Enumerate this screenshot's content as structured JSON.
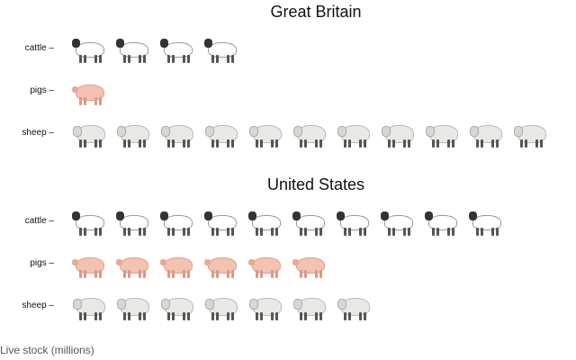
{
  "chart_data": {
    "type": "pictogram",
    "caption": "Live stock (millions)",
    "categories": [
      "cattle",
      "pigs",
      "sheep"
    ],
    "panels": [
      {
        "title": "Great Britain",
        "values": {
          "cattle": 4,
          "pigs": 1,
          "sheep": 11
        }
      },
      {
        "title": "United States",
        "values": {
          "cattle": 10,
          "pigs": 6,
          "sheep": 7
        }
      }
    ],
    "colors": {
      "cattle": "#ffffff",
      "pigs": "#f3c2b0",
      "sheep": "#e8e8e4"
    }
  }
}
